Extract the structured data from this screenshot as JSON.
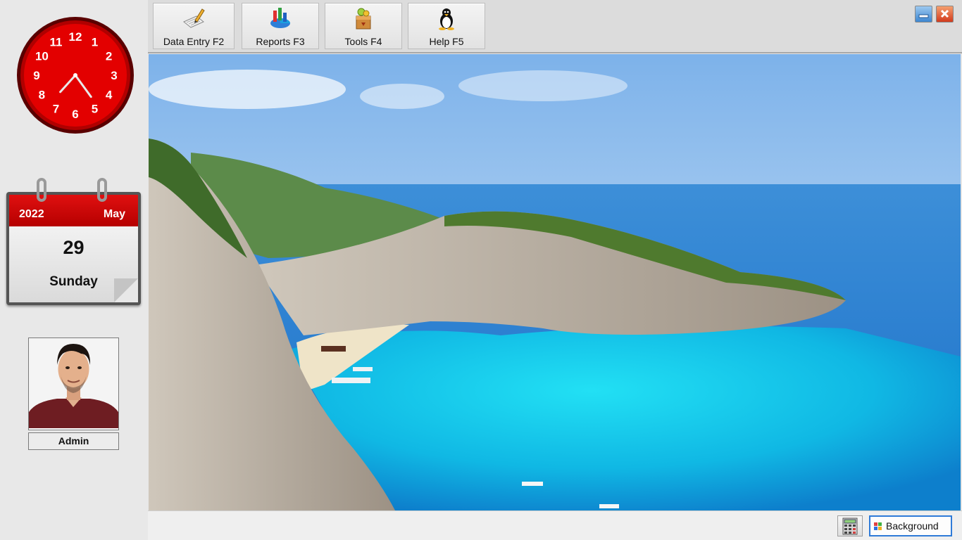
{
  "toolbar": {
    "buttons": [
      {
        "label": "Data Entry F2",
        "icon": "data-entry-icon"
      },
      {
        "label": "Reports F3",
        "icon": "reports-icon"
      },
      {
        "label": "Tools F4",
        "icon": "tools-icon"
      },
      {
        "label": "Help F5",
        "icon": "help-icon"
      }
    ]
  },
  "window_controls": {
    "minimize_icon": "minimize-icon",
    "close_icon": "close-icon"
  },
  "clock": {
    "numbers": [
      "12",
      "1",
      "2",
      "3",
      "4",
      "5",
      "6",
      "7",
      "8",
      "9",
      "10",
      "11"
    ],
    "hour": 7,
    "minute": 24,
    "face_color": "#e00000"
  },
  "calendar": {
    "year": "2022",
    "month": "May",
    "day": "29",
    "weekday": "Sunday"
  },
  "user": {
    "name": "Admin"
  },
  "status_bar": {
    "calculator_icon": "calculator-icon",
    "background_label": "Background"
  },
  "colors": {
    "accent_red": "#d40000",
    "sea": "#1cc4e6",
    "sky": "#9fc8ef",
    "button_border": "#2f7bd8"
  }
}
